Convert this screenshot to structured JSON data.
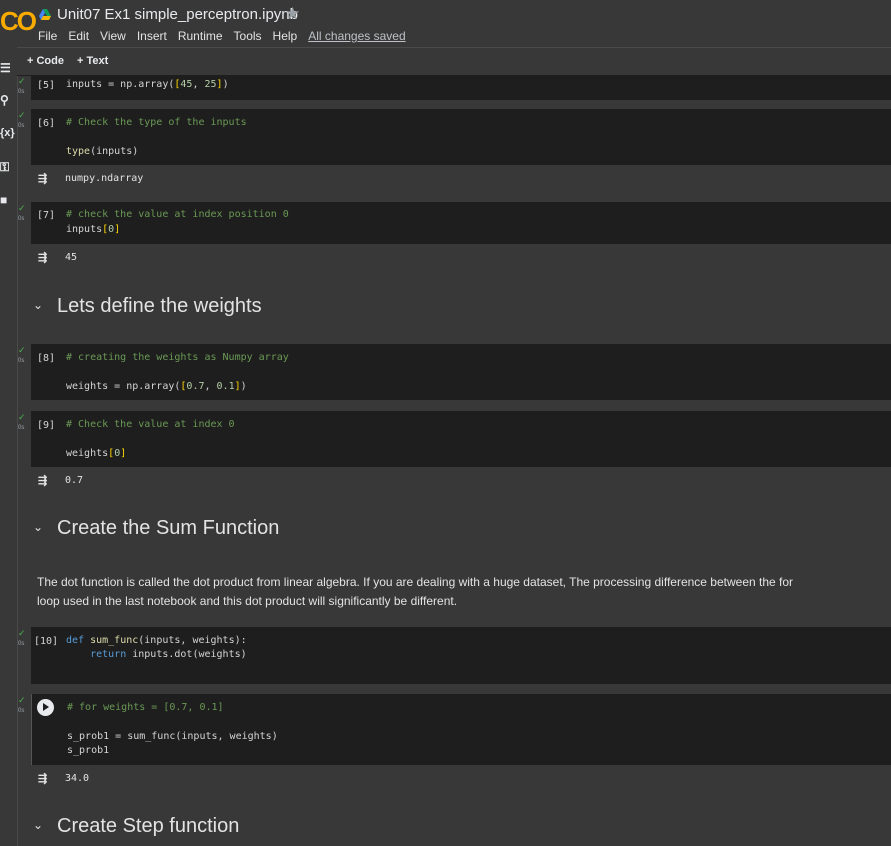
{
  "app": {
    "logo": "CO",
    "notebook_title": "Unit07 Ex1 simple_perceptron.ipynb",
    "star": "★",
    "menu": [
      "File",
      "Edit",
      "View",
      "Insert",
      "Runtime",
      "Tools",
      "Help"
    ],
    "save_status": "All changes saved"
  },
  "toolbar": {
    "add_code": "+ Code",
    "add_text": "+ Text"
  },
  "sidebar": {
    "icons": [
      "menu-icon",
      "search-icon",
      "variables-icon",
      "key-icon",
      "files-icon"
    ]
  },
  "cells": {
    "c5": {
      "prompt": "[5]",
      "secs": "0s",
      "line1": "inputs = np.array([45, 25])"
    },
    "c6": {
      "prompt": "[6]",
      "secs": "0s",
      "line1": "# Check the type of the inputs",
      "line2": "type(inputs)",
      "output": "numpy.ndarray"
    },
    "c7": {
      "prompt": "[7]",
      "secs": "0s",
      "line1": "# check the value at index position 0",
      "line2": "inputs[0]",
      "output": "45"
    },
    "c8": {
      "prompt": "[8]",
      "secs": "0s",
      "line1": "# creating the weights as Numpy array",
      "line2": "weights = np.array([0.7, 0.1])"
    },
    "c9": {
      "prompt": "[9]",
      "secs": "0s",
      "line1": "# Check the value at index 0",
      "line2": "weights[0]",
      "output": "0.7"
    },
    "c10": {
      "prompt": "[10]",
      "secs": "0s",
      "line1": "def sum_func(inputs, weights):",
      "line2": "    return inputs.dot(weights)"
    },
    "c11": {
      "secs": "0s",
      "line1": "# for weights = [0.7, 0.1]",
      "line2": "s_prob1 = sum_func(inputs, weights)",
      "line3": "s_prob1",
      "output": "34.0"
    }
  },
  "sections": {
    "weights": "Lets define the weights",
    "sum": "Create the Sum Function",
    "step": "Create Step function"
  },
  "text_cell": "The dot function is called the dot product from linear algebra. If you are dealing with a huge dataset, The processing difference between the for loop used in the last notebook and this dot product will significantly be different."
}
